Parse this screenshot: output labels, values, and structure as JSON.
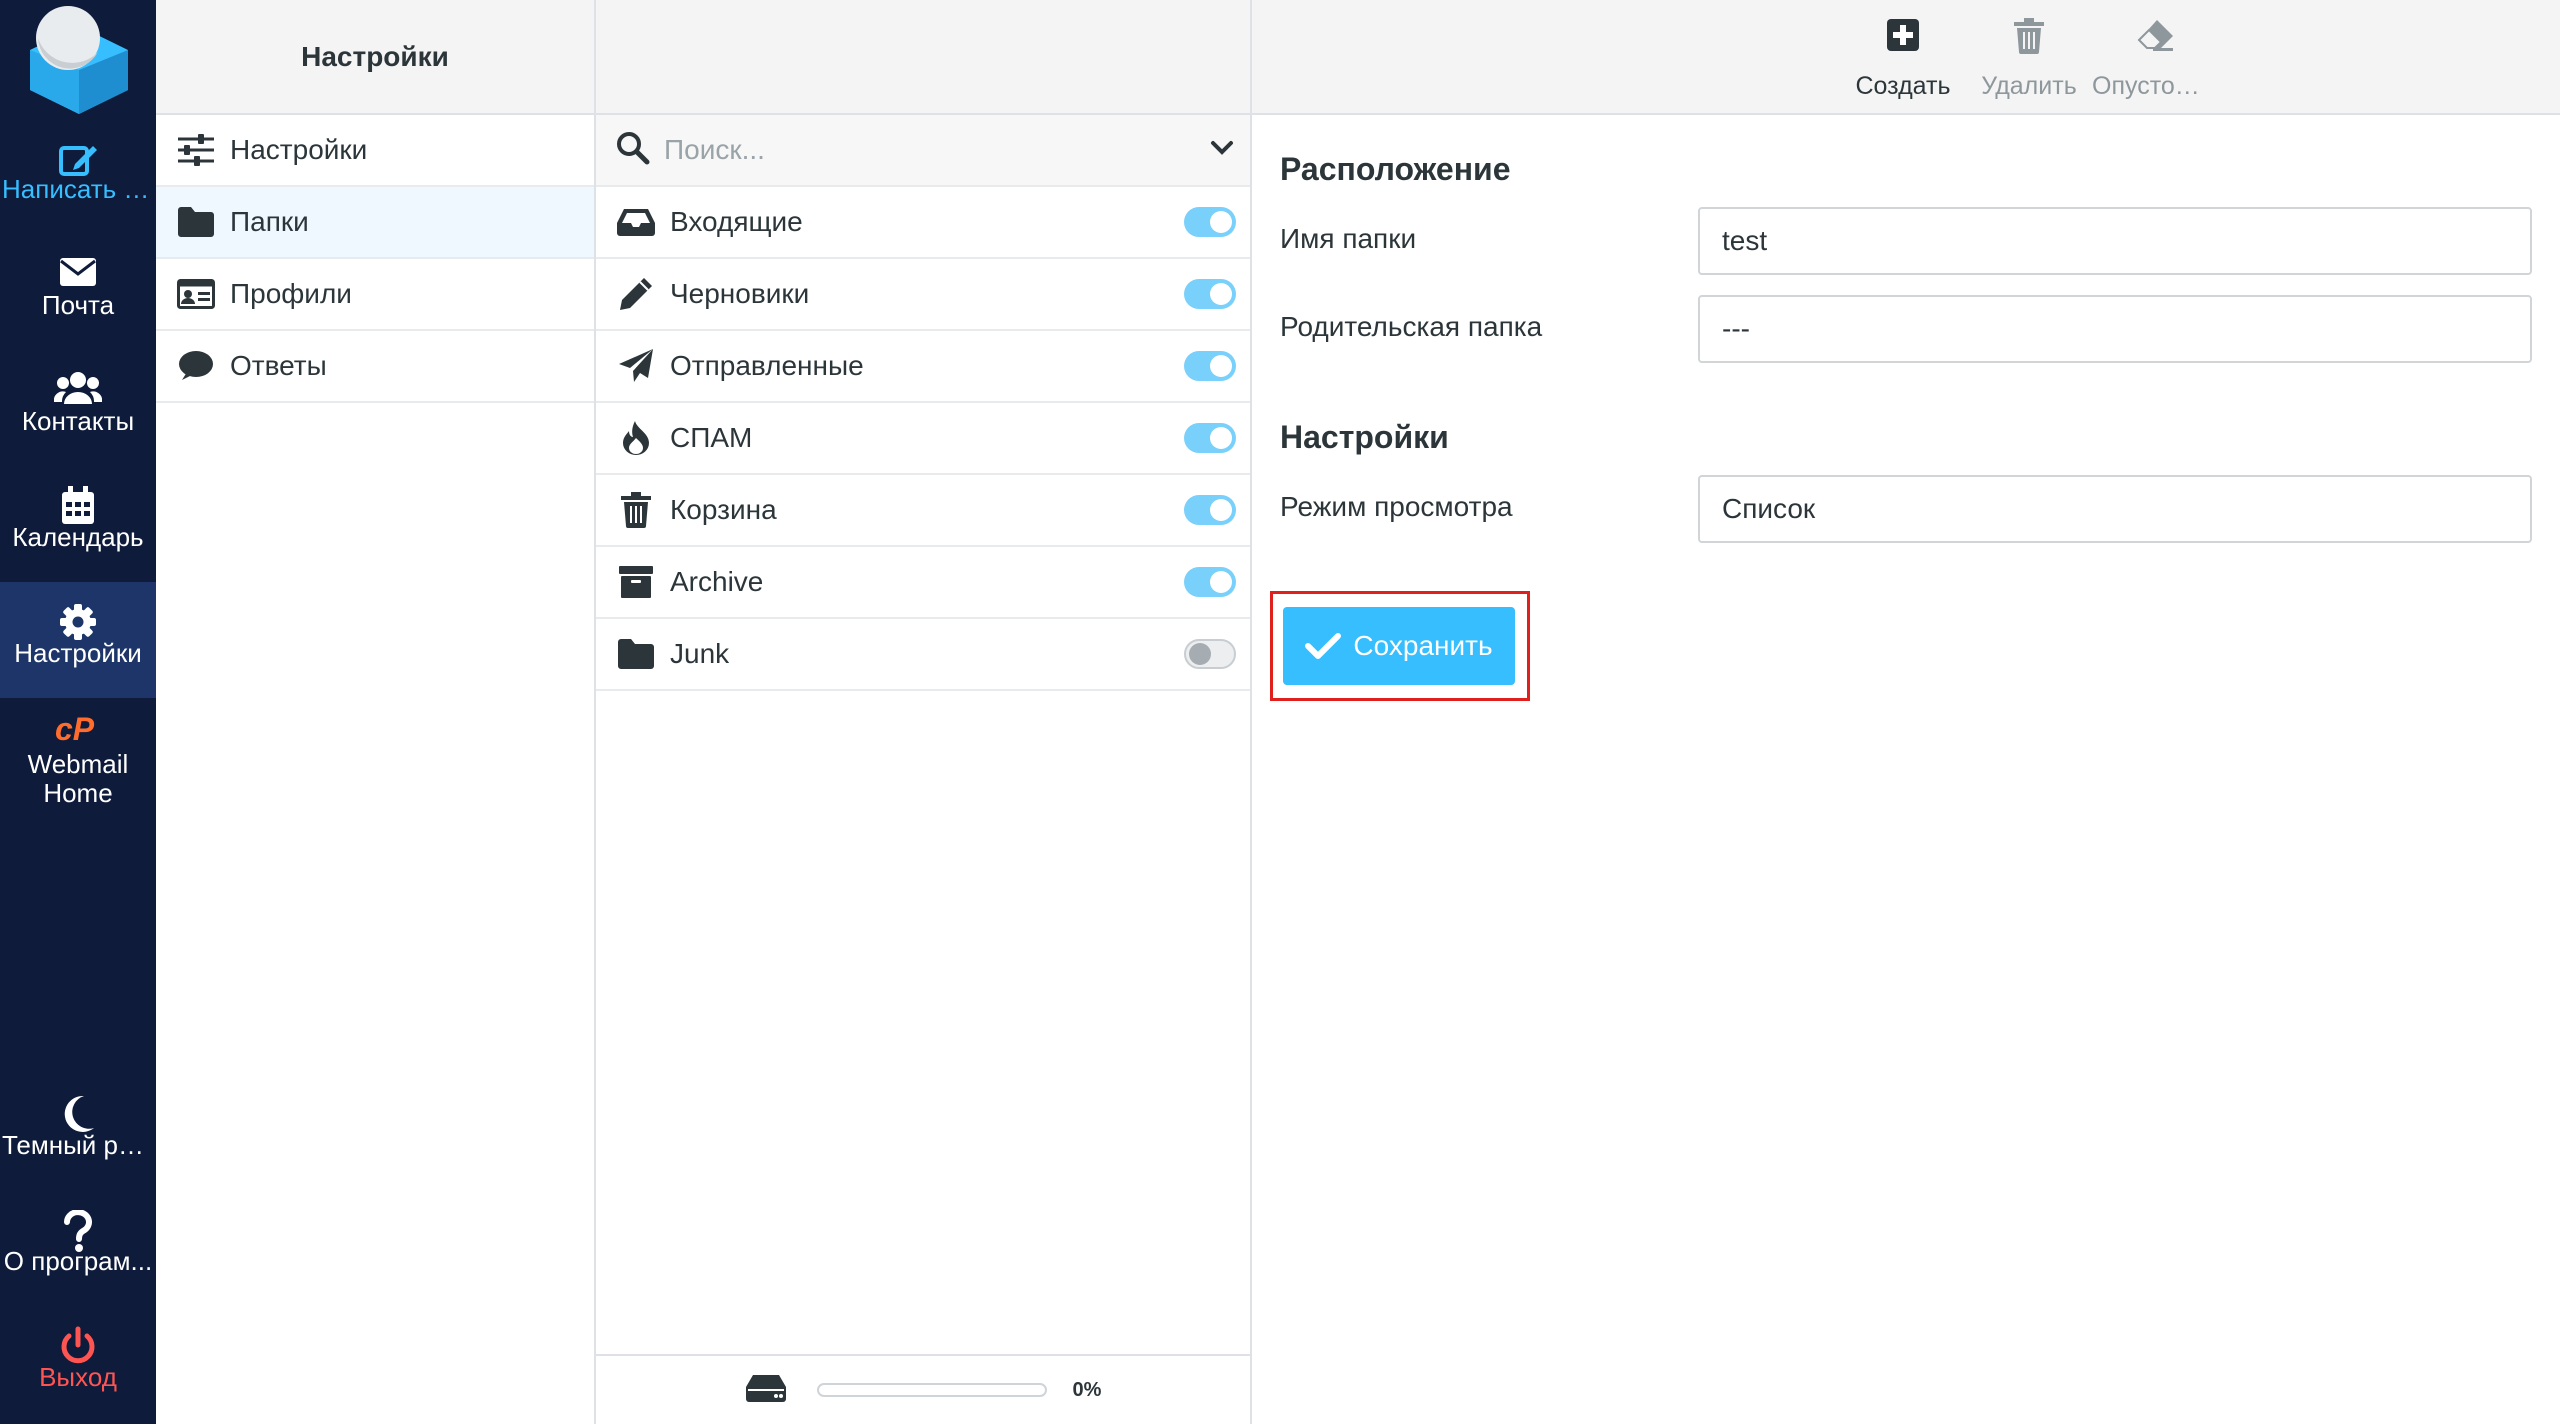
{
  "nav": {
    "compose": "Написать с...",
    "mail": "Почта",
    "contacts": "Контакты",
    "calendar": "Календарь",
    "settings": "Настройки",
    "webmail_home": "Webmail Home",
    "dark_mode": "Темный ре...",
    "about": "О програм...",
    "logout": "Выход"
  },
  "settings_column": {
    "title": "Настройки",
    "items": [
      {
        "label": "Настройки",
        "icon": "sliders-icon"
      },
      {
        "label": "Папки",
        "icon": "folder-icon"
      },
      {
        "label": "Профили",
        "icon": "id-card-icon"
      },
      {
        "label": "Ответы",
        "icon": "comment-icon"
      }
    ]
  },
  "folders_column": {
    "search": {
      "placeholder": "Поиск..."
    },
    "folders": [
      {
        "name": "Входящие",
        "icon": "inbox-icon",
        "subscribed": true
      },
      {
        "name": "Черновики",
        "icon": "pencil-icon",
        "subscribed": true
      },
      {
        "name": "Отправленные",
        "icon": "paper-plane-icon",
        "subscribed": true
      },
      {
        "name": "СПАМ",
        "icon": "fire-icon",
        "subscribed": true
      },
      {
        "name": "Корзина",
        "icon": "trash-icon",
        "subscribed": true
      },
      {
        "name": "Archive",
        "icon": "archive-icon",
        "subscribed": true
      },
      {
        "name": "Junk",
        "icon": "folder-icon",
        "subscribed": false
      }
    ],
    "quota": {
      "percent": 0,
      "label": "0%"
    }
  },
  "toolbar": {
    "create": "Создать",
    "delete": "Удалить",
    "empty": "Опустоши..."
  },
  "form": {
    "location_title": "Расположение",
    "folder_name_label": "Имя папки",
    "folder_name_value": "test",
    "parent_folder_label": "Родительская папка",
    "parent_folder_value": "---",
    "settings_title": "Настройки",
    "view_mode_label": "Режим просмотра",
    "view_mode_value": "Список",
    "save_label": "Сохранить"
  },
  "colors": {
    "nav_bg": "#0e1b3a",
    "nav_active": "#1d3569",
    "accent": "#37beff",
    "logout": "#ff5552",
    "highlight_frame": "#e0201c"
  }
}
